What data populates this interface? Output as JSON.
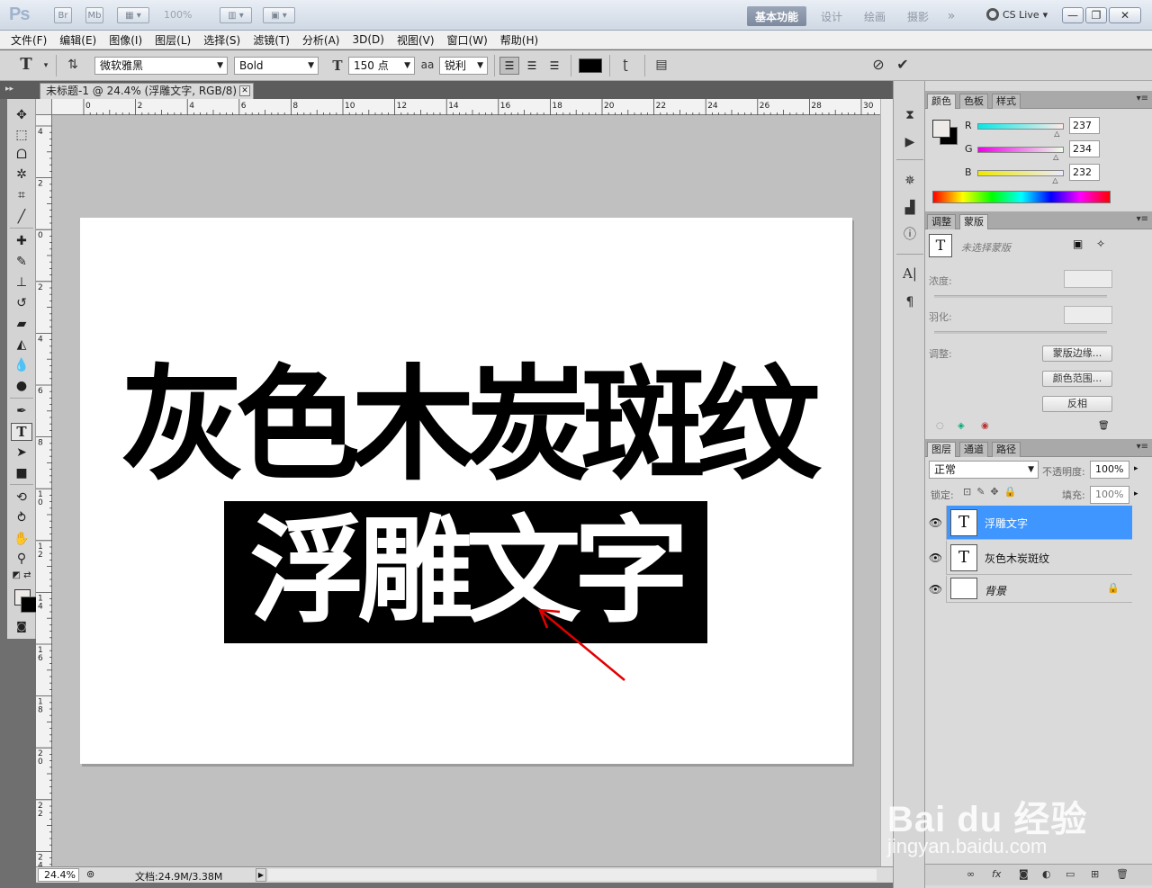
{
  "appbar": {
    "logo": "Ps",
    "btn_br": "Br",
    "btn_mb": "Mb",
    "zoom": "100%",
    "workspaces": [
      "基本功能",
      "设计",
      "绘画",
      "摄影"
    ],
    "more": "»",
    "cs_live": "CS Live"
  },
  "menu": [
    "文件(F)",
    "编辑(E)",
    "图像(I)",
    "图层(L)",
    "选择(S)",
    "滤镜(T)",
    "分析(A)",
    "3D(D)",
    "视图(V)",
    "窗口(W)",
    "帮助(H)"
  ],
  "options": {
    "font_family": "微软雅黑",
    "font_style": "Bold",
    "font_size": "150 点",
    "aa_icon": "aa",
    "antialias": "锐利",
    "text_color": "#000000"
  },
  "document": {
    "tab_title": "未标题-1 @ 24.4% (浮雕文字, RGB/8) *",
    "text_line1": "灰色木炭斑纹",
    "text_line2": "浮雕文字",
    "hruler_labels": [
      "0",
      "2",
      "4",
      "6",
      "8",
      "10",
      "12",
      "14",
      "16",
      "18",
      "20",
      "22",
      "24",
      "26",
      "28",
      "30"
    ],
    "vruler_labels": [
      "4",
      "2",
      "0",
      "2",
      "4",
      "6",
      "8",
      "10",
      "12",
      "14",
      "16",
      "18",
      "20",
      "22",
      "24"
    ]
  },
  "status": {
    "zoom": "24.4%",
    "doc": "文档:24.9M/3.38M"
  },
  "color_panel": {
    "tabs": [
      "颜色",
      "色板",
      "样式"
    ],
    "r_label": "R",
    "g_label": "G",
    "b_label": "B",
    "r": "237",
    "g": "234",
    "b": "232"
  },
  "masks_panel": {
    "tabs": [
      "调整",
      "蒙版"
    ],
    "title": "未选择蒙版",
    "density": "浓度:",
    "feather": "羽化:",
    "refine": "调整:",
    "btn_edge": "蒙版边缘...",
    "btn_range": "颜色范围...",
    "btn_invert": "反相"
  },
  "layers_panel": {
    "tabs": [
      "图层",
      "通道",
      "路径"
    ],
    "blend": "正常",
    "opacity_label": "不透明度:",
    "opacity": "100%",
    "lock_label": "锁定:",
    "fill_label": "填充:",
    "fill": "100%",
    "layers": [
      {
        "name": "浮雕文字",
        "thumb": "T"
      },
      {
        "name": "灰色木炭斑纹",
        "thumb": "T"
      },
      {
        "name": "背景",
        "thumb": ""
      }
    ]
  },
  "watermark": {
    "brand": "Bai du 经验",
    "url": "jingyan.baidu.com"
  }
}
